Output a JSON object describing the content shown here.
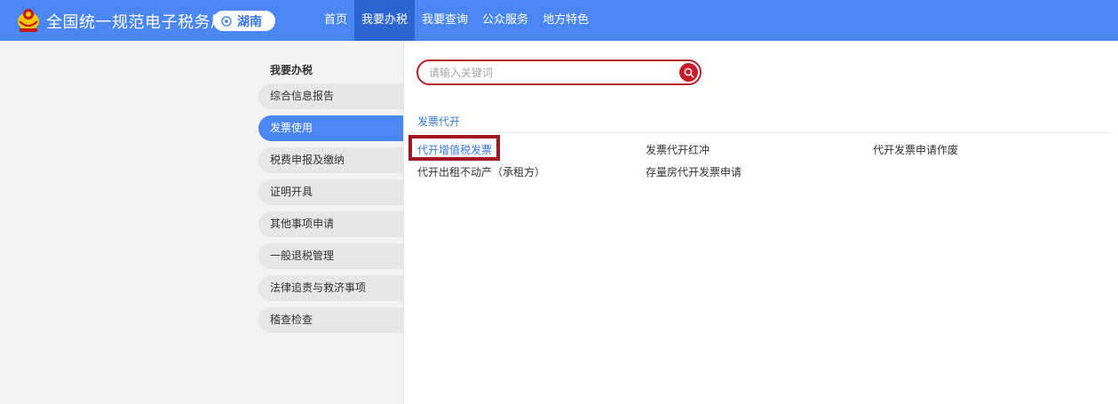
{
  "header": {
    "site_title": "全国统一规范电子税务局",
    "region": "湖南",
    "nav": [
      {
        "label": "首页",
        "active": false
      },
      {
        "label": "我要办税",
        "active": true
      },
      {
        "label": "我要查询",
        "active": false
      },
      {
        "label": "公众服务",
        "active": false
      },
      {
        "label": "地方特色",
        "active": false
      }
    ],
    "brand_color": "#4a87f2"
  },
  "sidebar": {
    "title": "我要办税",
    "items": [
      {
        "label": "综合信息报告",
        "active": false
      },
      {
        "label": "发票使用",
        "active": true
      },
      {
        "label": "税费申报及缴纳",
        "active": false
      },
      {
        "label": "证明开具",
        "active": false
      },
      {
        "label": "其他事项申请",
        "active": false
      },
      {
        "label": "一般退税管理",
        "active": false
      },
      {
        "label": "法律追责与救济事项",
        "active": false
      },
      {
        "label": "稽查检查",
        "active": false
      }
    ]
  },
  "search": {
    "placeholder": "请输入关键词",
    "value": ""
  },
  "main": {
    "section_title": "发票代开",
    "links": [
      {
        "label": "代开增值税发票",
        "selected": true
      },
      {
        "label": "发票代开红冲",
        "selected": false
      },
      {
        "label": "代开发票申请作废",
        "selected": false
      },
      {
        "label": "代开出租不动产（承租方）",
        "selected": false
      },
      {
        "label": "存量房代开发票申请",
        "selected": false
      }
    ]
  },
  "icons": {
    "emblem": "tax-emblem-icon",
    "region": "location-pin-icon",
    "search": "search-icon"
  }
}
